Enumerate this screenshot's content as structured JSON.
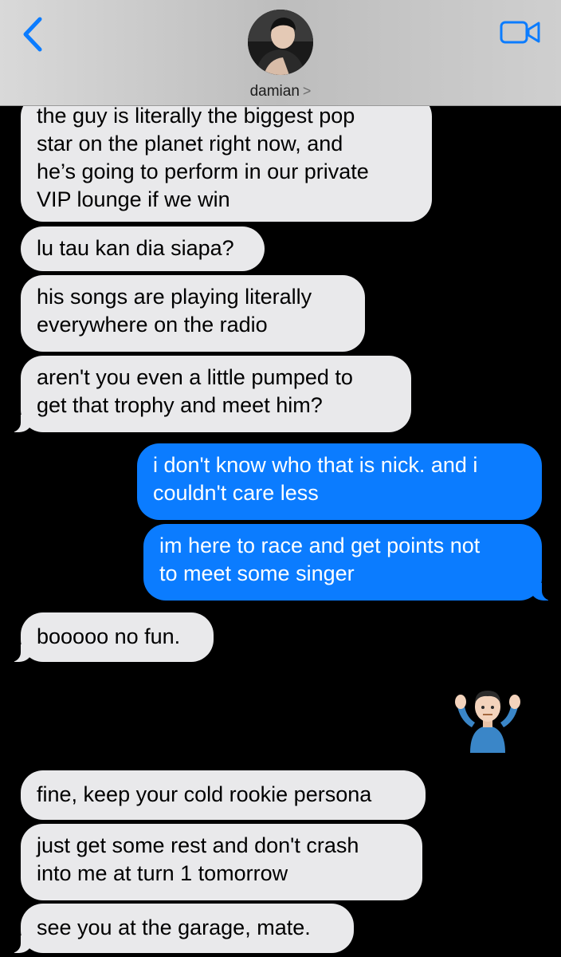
{
  "header": {
    "contact_name": "damian",
    "chevron": ">",
    "icons": {
      "back": "chevron-left-icon",
      "video": "video-camera-icon"
    },
    "accent_color": "#0b7cff"
  },
  "messages": [
    {
      "side": "in",
      "lines": [
        "the guy is literally the biggest pop",
        "star on the planet right now, and",
        "he’s going to perform in our private",
        "VIP lounge if we win"
      ]
    },
    {
      "side": "in",
      "lines": [
        "lu tau kan dia siapa?"
      ]
    },
    {
      "side": "in",
      "lines": [
        "his songs are playing literally",
        "everywhere on the radio"
      ]
    },
    {
      "side": "in",
      "lines": [
        "aren't you even a little pumped to",
        "get that trophy and meet him?"
      ]
    },
    {
      "side": "out",
      "lines": [
        "i don't know who that is nick. and i",
        "couldn't care less"
      ]
    },
    {
      "side": "out",
      "lines": [
        "im here to race and get points not",
        "to meet some singer"
      ]
    },
    {
      "side": "in",
      "lines": [
        "booooo no fun."
      ]
    },
    {
      "side": "out",
      "emoji": "person-shrugging-emoji"
    },
    {
      "side": "in",
      "lines": [
        "fine, keep your cold rookie persona"
      ]
    },
    {
      "side": "in",
      "lines": [
        "just get some rest and don't crash",
        "into me at turn 1 tomorrow"
      ]
    },
    {
      "side": "in",
      "lines": [
        "see you at the garage, mate."
      ]
    }
  ],
  "colors": {
    "incoming_bubble": "#e9e9eb",
    "outgoing_bubble": "#0b7cff",
    "background": "#000000"
  }
}
